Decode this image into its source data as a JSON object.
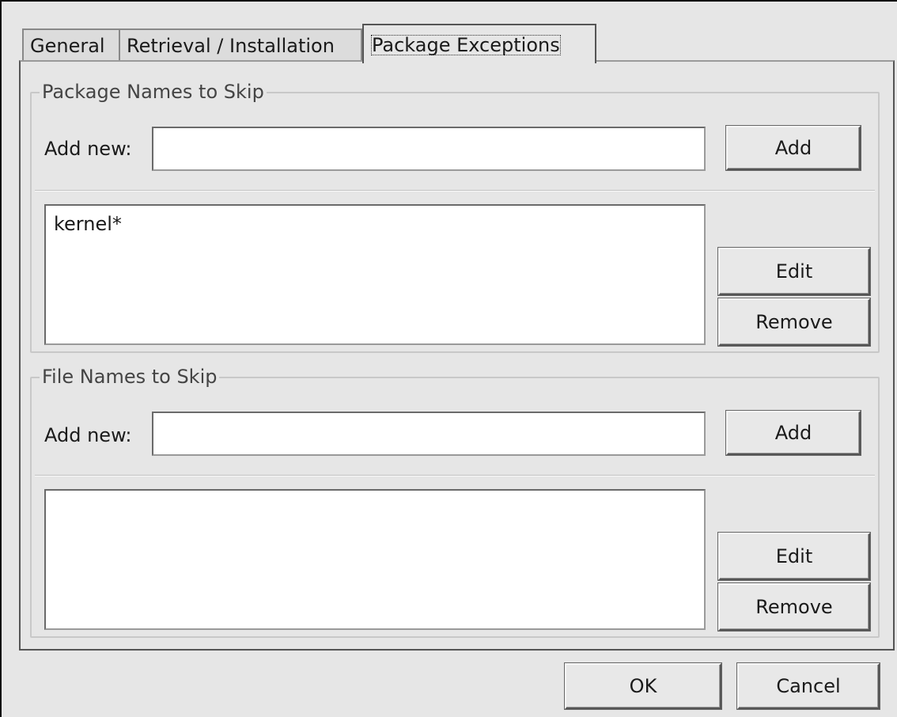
{
  "tabs": [
    {
      "label": "General"
    },
    {
      "label": "Retrieval / Installation"
    },
    {
      "label": "Package Exceptions"
    }
  ],
  "active_tab": "Package Exceptions",
  "package_section": {
    "title": "Package Names to Skip",
    "add_label": "Add new:",
    "add_value": "",
    "add_button": "Add",
    "items": [
      "kernel*"
    ],
    "edit_button": "Edit",
    "remove_button": "Remove"
  },
  "file_section": {
    "title": "File Names to Skip",
    "add_label": "Add new:",
    "add_value": "",
    "add_button": "Add",
    "items": [],
    "edit_button": "Edit",
    "remove_button": "Remove"
  },
  "dialog": {
    "ok_button": "OK",
    "cancel_button": "Cancel"
  }
}
